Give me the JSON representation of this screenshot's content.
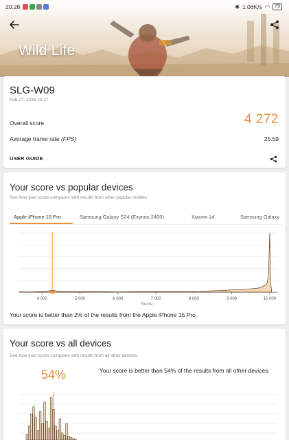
{
  "status_bar": {
    "time": "20:28",
    "network_speed": "1.06K/s",
    "battery": "79"
  },
  "hero": {
    "title": "Wild Life",
    "back_icon": "back-arrow-icon",
    "share_icon": "share-icon"
  },
  "result": {
    "device_name": "SLG-W09",
    "date": "Feb 27, 2026 20:27",
    "overall_label": "Overall score",
    "overall_value": "4 272",
    "fps_label_prefix": "Average frame rate ",
    "fps_label_unit": "(FPS)",
    "fps_value": "25.59",
    "user_guide": "USER GUIDE"
  },
  "popular": {
    "title": "Your score vs popular devices",
    "subtitle": "See how your score compares with results from other popular models.",
    "tabs": [
      "Apple iPhone 15 Pro",
      "Samsung Galaxy S24 (Exynos 2400)",
      "Xiaomi 14",
      "Samsung Galaxy"
    ],
    "active_tab": 0,
    "better_than": "Your score is better than 2% of the results from the Apple iPhone 15 Pro.",
    "accent_color": "#e5913a"
  },
  "all_devices": {
    "title": "Your score vs all devices",
    "subtitle": "See how your score compares with results from all other devices.",
    "percent": "54%",
    "better_than": "Your score is better than 54% of the results from all other devices."
  },
  "chart_data": [
    {
      "type": "area",
      "xlabel": "Score",
      "ylabel": "",
      "xlim": [
        3400,
        10200
      ],
      "ylim": [
        0,
        100
      ],
      "xticks": [
        "4 000",
        "5 000",
        "6 000",
        "7 000",
        "8 000",
        "9 000",
        "10 000"
      ],
      "xtick_values": [
        4000,
        5000,
        6000,
        7000,
        8000,
        9000,
        10000
      ],
      "grid": true,
      "marker_score": 4272,
      "series": [
        {
          "x": [
            3400,
            3700,
            4000,
            4150,
            4250,
            4300,
            4400,
            4600,
            5000,
            5500,
            6000,
            6500,
            7000,
            7500,
            8000,
            8300,
            8600,
            8800,
            9000,
            9200,
            9400,
            9550,
            9700,
            9800,
            9850,
            9900,
            9930,
            9960,
            9980,
            10000,
            10020,
            10050
          ],
          "y": [
            0.5,
            0.5,
            1,
            2,
            3,
            3,
            2,
            1,
            1,
            1,
            0.5,
            1,
            1,
            1,
            1.5,
            2,
            2.5,
            3,
            4,
            4,
            5,
            6,
            7,
            9,
            11,
            12,
            16,
            25,
            55,
            100,
            20,
            1
          ]
        }
      ]
    },
    {
      "type": "bar",
      "xlabel": "",
      "ylabel": "",
      "grid": true,
      "marker_score": 4272,
      "values": [
        12,
        30,
        55,
        70,
        48,
        20,
        60,
        35,
        80,
        40,
        25,
        90,
        65,
        30,
        20,
        45,
        15,
        10,
        35,
        8,
        5,
        3,
        2
      ]
    }
  ]
}
